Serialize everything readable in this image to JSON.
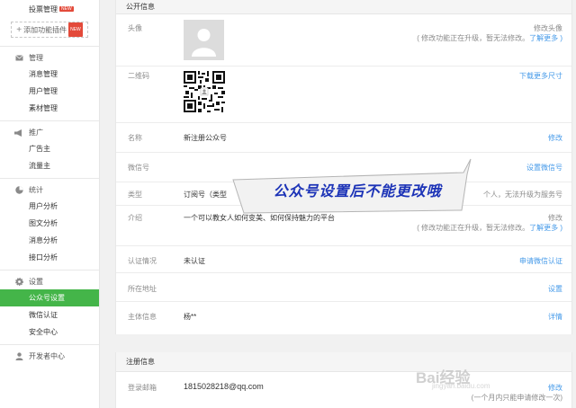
{
  "sidebar": {
    "top_item": "投票管理",
    "new_badge": "NEW",
    "add_plugin": "添加功能插件",
    "groups": [
      {
        "title": "管理",
        "icon": "mail-icon",
        "items": [
          "消息管理",
          "用户管理",
          "素材管理"
        ]
      },
      {
        "title": "推广",
        "icon": "megaphone-icon",
        "items": [
          "广告主",
          "流量主"
        ]
      },
      {
        "title": "统计",
        "icon": "chart-icon",
        "items": [
          "用户分析",
          "图文分析",
          "消息分析",
          "接口分析"
        ]
      },
      {
        "title": "设置",
        "icon": "gear-icon",
        "items": [
          "公众号设置",
          "微信认证",
          "安全中心"
        ]
      }
    ],
    "active_item": "公众号设置",
    "developer": "开发者中心",
    "accent": "#44b549"
  },
  "public_info": {
    "header": "公开信息",
    "avatar": {
      "label": "头像",
      "action": "修改头像",
      "note": "( 修改功能正在升级，暂无法修改。",
      "more": "了解更多 )"
    },
    "qrcode": {
      "label": "二维码",
      "action": "下载更多尺寸"
    },
    "name": {
      "label": "名称",
      "value": "新注册公众号",
      "action": "修改"
    },
    "wechat_id": {
      "label": "微信号",
      "action": "设置微信号"
    },
    "type": {
      "label": "类型",
      "value": "订阅号（类型",
      "note": "个人，无法升级为服务号"
    },
    "intro": {
      "label": "介绍",
      "value": "一个可以教女人如何变美、如何保持魅力的平台",
      "action": "修改",
      "note": "( 修改功能正在升级，暂无法修改。",
      "more": "了解更多 )"
    },
    "verify": {
      "label": "认证情况",
      "value": "未认证",
      "action": "申请微信认证"
    },
    "location": {
      "label": "所在地址",
      "action": "设置"
    },
    "subject": {
      "label": "主体信息",
      "value": "杨**",
      "action": "详情"
    }
  },
  "reg_info": {
    "header": "注册信息",
    "email": {
      "label": "登录邮箱",
      "value": "1815028218@qq.com",
      "action": "修改",
      "note": "(一个月内只能申请修改一次)"
    }
  },
  "banner_text": "公众号设置后不能更改哦",
  "watermark": {
    "main": "Bai经验",
    "sub": "jingyan.baidu.com"
  },
  "link_color": "#459ae9"
}
